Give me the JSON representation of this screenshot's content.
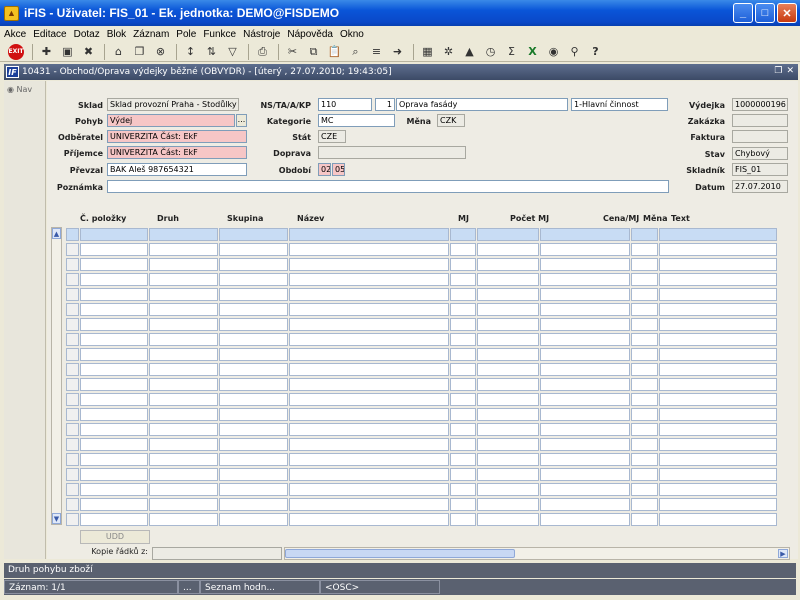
{
  "app": {
    "title": "iFIS - Uživatel: FIS_01 - Ek. jednotka: DEMO@FISDEMO",
    "app_icon": "ifis-app-icon"
  },
  "menu": [
    "Akce",
    "Editace",
    "Dotaz",
    "Blok",
    "Záznam",
    "Pole",
    "Funkce",
    "Nástroje",
    "Nápověda",
    "Okno"
  ],
  "toolbar": {
    "exit_label": "EXIT",
    "icons": [
      "exit-icon",
      "new-record-icon",
      "save-icon",
      "delete-record-icon",
      "clear-icon",
      "copy-record-icon",
      "remove-icon",
      "sort-asc-icon",
      "sort-desc-icon",
      "filter-icon",
      "print-icon",
      "cut-icon",
      "copy-icon",
      "paste-icon",
      "find-icon",
      "list-icon",
      "next-icon",
      "calculator-icon",
      "gear-icon",
      "chart-icon",
      "clock-icon",
      "sum-icon",
      "excel-icon",
      "export-icon",
      "help-search-icon",
      "help-icon"
    ]
  },
  "window": {
    "title": "10431 - Obchod/Oprava výdejky běžné (OBVYDR) - [úterý , 27.07.2010; 19:43:05]",
    "logo": "IF"
  },
  "nav": {
    "label": "Nav"
  },
  "form": {
    "sklad": {
      "label": "Sklad",
      "value": "Sklad provozní Praha - Stodůlky"
    },
    "pohyb": {
      "label": "Pohyb",
      "value": "Výdej",
      "dots": "..."
    },
    "odberatel": {
      "label": "Odběratel",
      "value": "UNIVERZITA Část: EkF"
    },
    "prijemce": {
      "label": "Příjemce",
      "value": "UNIVERZITA Část: EkF"
    },
    "prevzal": {
      "label": "Převzal",
      "value": "BAK Aleš 987654321"
    },
    "poznamka": {
      "label": "Poznámka",
      "value": ""
    },
    "ns": {
      "label": "NS/TA/A/KP",
      "v1": "110",
      "v2": "1",
      "v3": "Oprava fasády",
      "v4": "1-Hlavní činnost"
    },
    "kategorie": {
      "label": "Kategorie",
      "value": "MC"
    },
    "mena": {
      "label": "Měna",
      "value": "CZK"
    },
    "stat": {
      "label": "Stát",
      "value": "CZE"
    },
    "doprava": {
      "label": "Doprava",
      "value": ""
    },
    "obdobi": {
      "label": "Období",
      "v1": "02",
      "v2": "05"
    },
    "vydejka": {
      "label": "Výdejka",
      "value": "1000000196"
    },
    "zakazka": {
      "label": "Zakázka",
      "value": ""
    },
    "faktura": {
      "label": "Faktura",
      "value": ""
    },
    "stav": {
      "label": "Stav",
      "value": "Chybový"
    },
    "skladnik": {
      "label": "Skladník",
      "value": "FIS_01"
    },
    "datum": {
      "label": "Datum",
      "value": "27.07.2010"
    }
  },
  "grid": {
    "columns": [
      "Č. položky",
      "Druh",
      "Skupina",
      "Název",
      "MJ",
      "Počet MJ",
      "Cena/MJ",
      "Měna",
      "Text"
    ]
  },
  "bottom": {
    "udd_label": "UDD",
    "kopie_label": "Kopie řádků z:"
  },
  "status": {
    "message": "Druh pohybu zboží",
    "record": "Záznam: 1/1",
    "seg2": "...",
    "seg3": "Seznam hodn...",
    "seg4": "<OSC>"
  }
}
